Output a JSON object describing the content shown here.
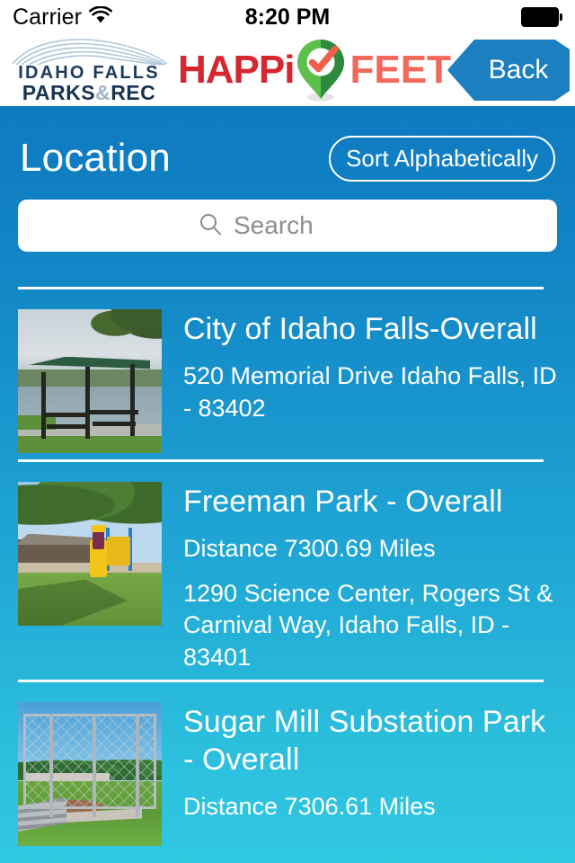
{
  "status_bar": {
    "carrier": "Carrier",
    "wifi_icon": "wifi-icon",
    "time": "8:20 PM",
    "battery_icon": "battery-full-icon"
  },
  "header": {
    "org_logo": {
      "line1": "IDAHO FALLS",
      "line2_a": "PARKS",
      "line2_amp": "&",
      "line2_b": "REC",
      "swoosh_icon": "wave-swoosh-icon",
      "colors": {
        "text": "#16334f",
        "amp": "#9fb4c7",
        "swoosh": "#a8c0d8"
      }
    },
    "app_logo": {
      "word1": "HAPPi",
      "word2": "FEET",
      "pin_icon": "map-pin-check-icon",
      "colors": {
        "word1": "#d62630",
        "word2": "#f2695c",
        "pin_light": "#5cc04a",
        "pin_dark": "#2e8b3d",
        "check": "#ef5f4a"
      }
    },
    "back_button": {
      "label": "Back",
      "color": "#1b7fc0"
    }
  },
  "page": {
    "title": "Location",
    "sort_button_label": "Sort Alphabetically",
    "background_top_color": "#0f7ac0",
    "background_bottom_color": "#31c8e2"
  },
  "search": {
    "placeholder": "Search",
    "value": "",
    "icon": "search-icon"
  },
  "locations": [
    {
      "name": "City of Idaho Falls-Overall",
      "distance": "",
      "address": "520 Memorial Drive Idaho Falls, ID - 83402",
      "thumbnail_alt": "park-pavilion-by-river-photo"
    },
    {
      "name": "Freeman Park - Overall",
      "distance": "Distance 7300.69 Miles",
      "address": "1290 Science Center, Rogers St & Carnival Way, Idaho Falls, ID - 83401",
      "thumbnail_alt": "park-shelter-with-playground-photo"
    },
    {
      "name": "Sugar Mill Substation Park - Overall",
      "distance": "Distance 7306.61 Miles",
      "address": "",
      "thumbnail_alt": "baseball-field-backstop-photo"
    }
  ]
}
